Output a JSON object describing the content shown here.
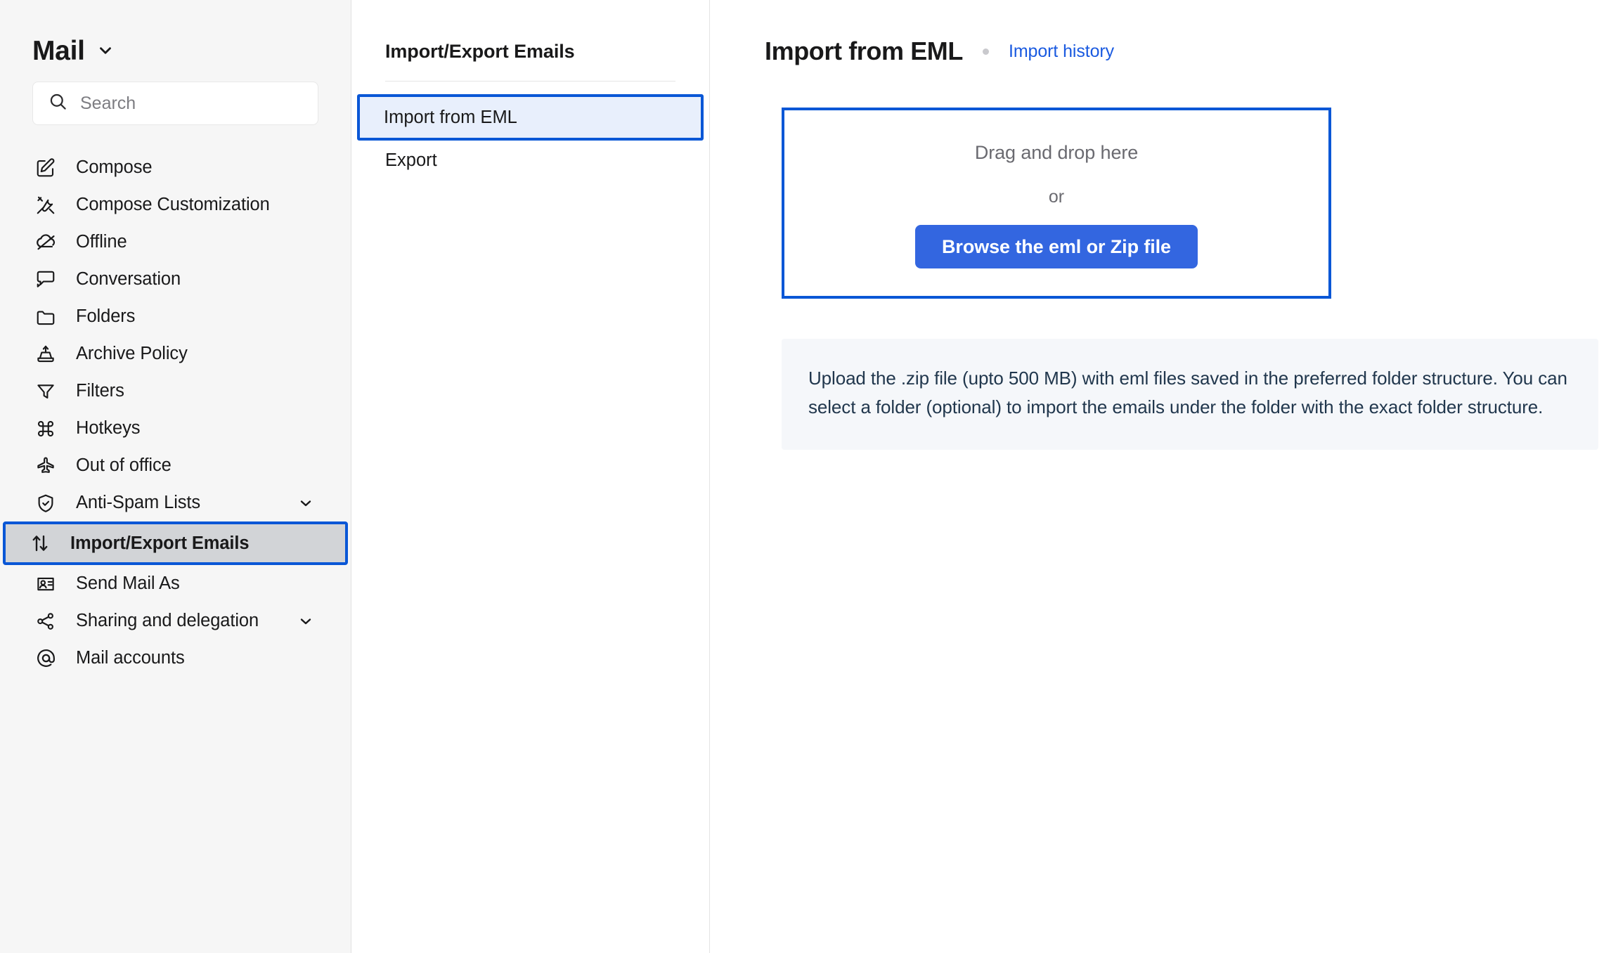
{
  "sidebar": {
    "brand": {
      "title": "Mail",
      "chevron_icon": "chevron-down-icon"
    },
    "search": {
      "placeholder": "Search",
      "value": "",
      "icon": "search-icon"
    },
    "items": [
      {
        "label": "Compose",
        "icon": "compose-pencil-icon",
        "selected": false,
        "expandable": false
      },
      {
        "label": "Compose Customization",
        "icon": "tools-wrench-screwdriver-icon",
        "selected": false,
        "expandable": false
      },
      {
        "label": "Offline",
        "icon": "cloud-offline-icon",
        "selected": false,
        "expandable": false
      },
      {
        "label": "Conversation",
        "icon": "conversation-bubbles-icon",
        "selected": false,
        "expandable": false
      },
      {
        "label": "Folders",
        "icon": "folder-icon",
        "selected": false,
        "expandable": false
      },
      {
        "label": "Archive Policy",
        "icon": "archive-inbox-icon",
        "selected": false,
        "expandable": false
      },
      {
        "label": "Filters",
        "icon": "filter-funnel-icon",
        "selected": false,
        "expandable": false
      },
      {
        "label": "Hotkeys",
        "icon": "command-key-icon",
        "selected": false,
        "expandable": false
      },
      {
        "label": "Out of office",
        "icon": "airplane-icon",
        "selected": false,
        "expandable": false
      },
      {
        "label": "Anti-Spam Lists",
        "icon": "shield-check-icon",
        "selected": false,
        "expandable": true
      },
      {
        "label": "Import/Export Emails",
        "icon": "arrows-up-down-icon",
        "selected": true,
        "expandable": false
      },
      {
        "label": "Send Mail As",
        "icon": "user-card-icon",
        "selected": false,
        "expandable": false
      },
      {
        "label": "Sharing and delegation",
        "icon": "share-nodes-icon",
        "selected": false,
        "expandable": true
      },
      {
        "label": "Mail accounts",
        "icon": "at-sign-icon",
        "selected": false,
        "expandable": false
      }
    ]
  },
  "midpanel": {
    "title": "Import/Export Emails",
    "items": [
      {
        "label": "Import from EML",
        "selected": true
      },
      {
        "label": "Export",
        "selected": false
      }
    ]
  },
  "main": {
    "title": "Import from EML",
    "history_link": "Import history",
    "dropzone": {
      "drag_text": "Drag and drop here",
      "or_text": "or",
      "browse_label": "Browse the eml or Zip file"
    },
    "info_text": "Upload the .zip file (upto 500 MB) with eml files saved in the preferred folder structure. You can select a folder (optional) to import the emails under the folder with the exact folder structure."
  },
  "colors": {
    "accent_blue": "#0a57d6",
    "button_blue": "#3366e0",
    "link_blue": "#1a5ae0",
    "selected_sidebar_bg": "#d2d4d7",
    "selected_mid_bg": "#e8effc",
    "info_bg": "#f5f7fa",
    "sidebar_bg": "#f6f6f6"
  }
}
